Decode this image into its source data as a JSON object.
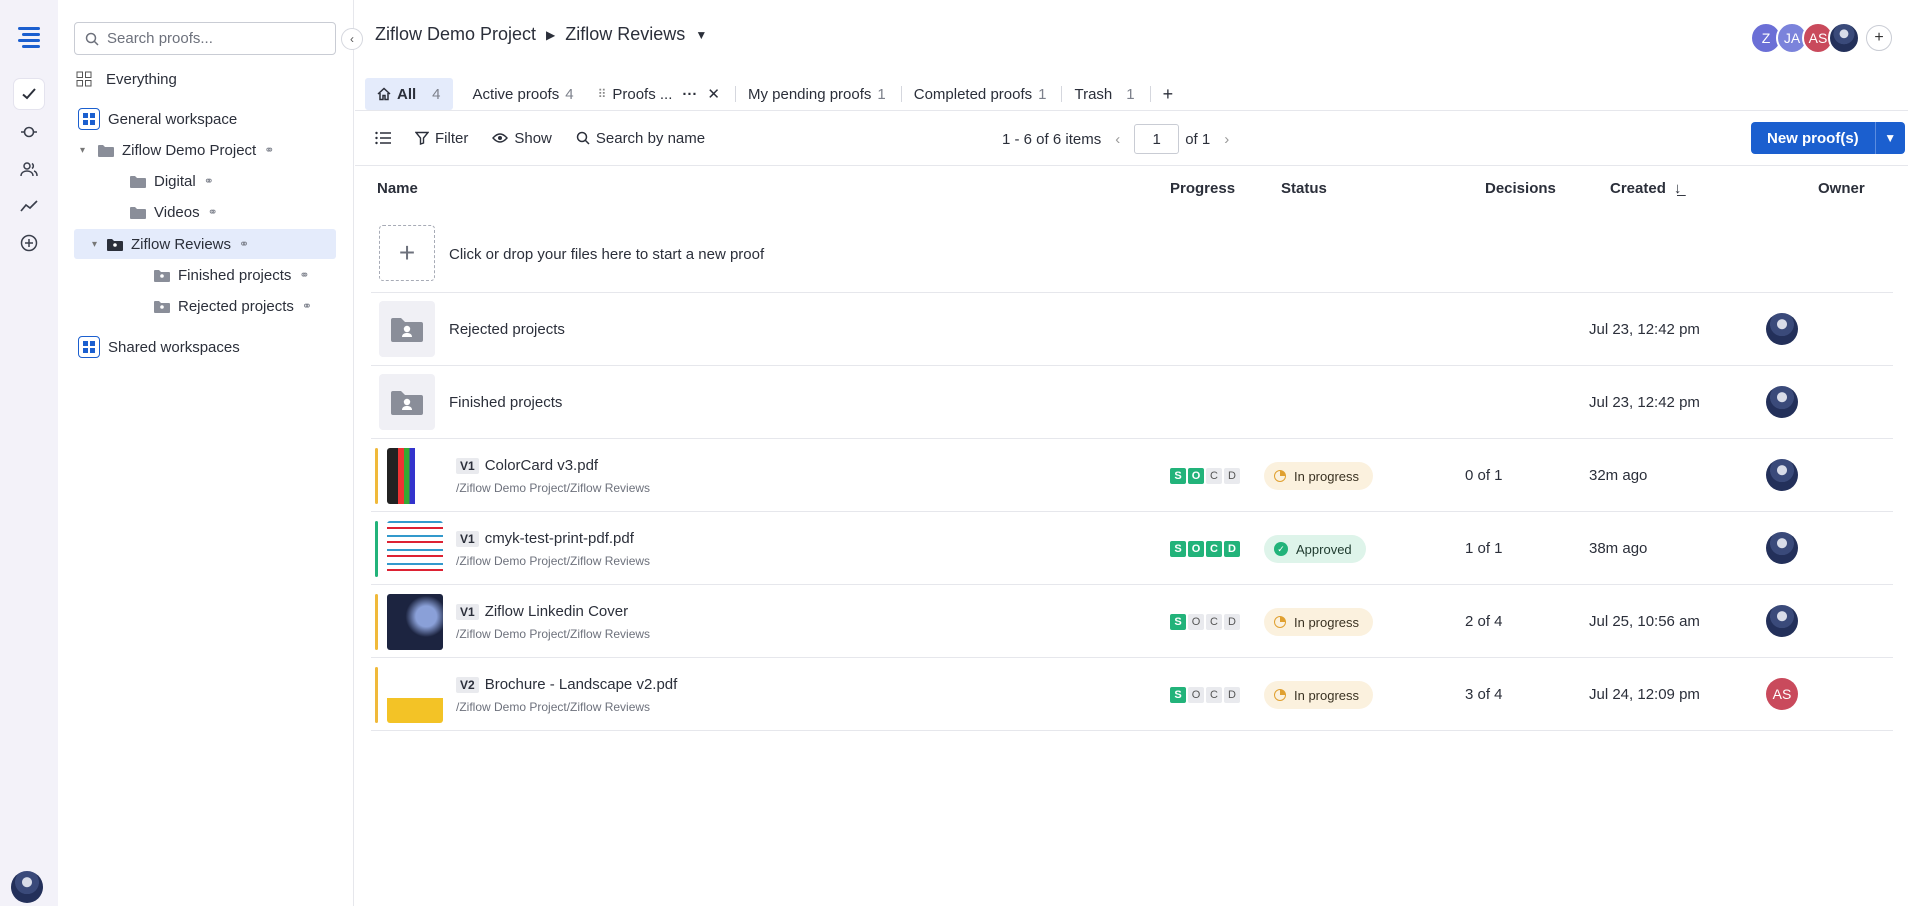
{
  "sidebar": {
    "search_placeholder": "Search proofs...",
    "items": [
      {
        "label": "Everything"
      },
      {
        "label": "General workspace"
      },
      {
        "label": "Ziflow Demo Project"
      },
      {
        "label": "Digital"
      },
      {
        "label": "Videos"
      },
      {
        "label": "Ziflow Reviews"
      },
      {
        "label": "Finished projects"
      },
      {
        "label": "Rejected projects"
      },
      {
        "label": "Shared workspaces"
      }
    ]
  },
  "breadcrumb": {
    "project": "Ziflow Demo Project",
    "folder": "Ziflow Reviews"
  },
  "collaborators": [
    {
      "initials": "Z",
      "color": "#6b6fd6"
    },
    {
      "initials": "JA",
      "color": "#7b83db"
    },
    {
      "initials": "AS",
      "color": "#c94a5c"
    }
  ],
  "tabs": [
    {
      "label": "All",
      "count": "4"
    },
    {
      "label": "Active proofs",
      "count": "4"
    },
    {
      "label": "Proofs ...",
      "count": ""
    },
    {
      "label": "My pending proofs",
      "count": "1"
    },
    {
      "label": "Completed proofs",
      "count": "1"
    },
    {
      "label": "Trash",
      "count": "1"
    }
  ],
  "toolbar": {
    "filter": "Filter",
    "show": "Show",
    "search": "Search by name"
  },
  "pager": {
    "range": "1 - 6 of 6 items",
    "page": "1",
    "of": "of 1"
  },
  "new_button": "New proof(s)",
  "columns": {
    "name": "Name",
    "progress": "Progress",
    "status": "Status",
    "decisions": "Decisions",
    "created": "Created",
    "owner": "Owner"
  },
  "dropzone_text": "Click or drop your files here to start a new proof",
  "folders": [
    {
      "name": "Rejected projects",
      "created": "Jul 23, 12:42 pm"
    },
    {
      "name": "Finished projects",
      "created": "Jul 23, 12:42 pm"
    }
  ],
  "proofs": [
    {
      "version": "V1",
      "name": "ColorCard v3.pdf",
      "path": "/Ziflow Demo Project/Ziflow Reviews",
      "progress": [
        "S",
        "O",
        "C",
        "D"
      ],
      "progress_on": [
        true,
        true,
        false,
        false
      ],
      "status": "In progress",
      "status_type": "ip",
      "decisions": "0 of 1",
      "created": "32m ago",
      "bar_color": "#f0b93a",
      "owner_initials": ""
    },
    {
      "version": "V1",
      "name": "cmyk-test-print-pdf.pdf",
      "path": "/Ziflow Demo Project/Ziflow Reviews",
      "progress": [
        "S",
        "O",
        "C",
        "D"
      ],
      "progress_on": [
        true,
        true,
        true,
        true
      ],
      "status": "Approved",
      "status_type": "ap",
      "decisions": "1 of 1",
      "created": "38m ago",
      "bar_color": "#22b37a",
      "owner_initials": ""
    },
    {
      "version": "V1",
      "name": "Ziflow Linkedin Cover",
      "path": "/Ziflow Demo Project/Ziflow Reviews",
      "progress": [
        "S",
        "O",
        "C",
        "D"
      ],
      "progress_on": [
        true,
        false,
        false,
        false
      ],
      "status": "In progress",
      "status_type": "ip",
      "decisions": "2 of 4",
      "created": "Jul 25, 10:56 am",
      "bar_color": "#f0b93a",
      "owner_initials": ""
    },
    {
      "version": "V2",
      "name": "Brochure - Landscape v2.pdf",
      "path": "/Ziflow Demo Project/Ziflow Reviews",
      "progress": [
        "S",
        "O",
        "C",
        "D"
      ],
      "progress_on": [
        true,
        false,
        false,
        false
      ],
      "status": "In progress",
      "status_type": "ip",
      "decisions": "3 of 4",
      "created": "Jul 24, 12:09 pm",
      "bar_color": "#f0b93a",
      "owner_initials": "AS"
    }
  ]
}
